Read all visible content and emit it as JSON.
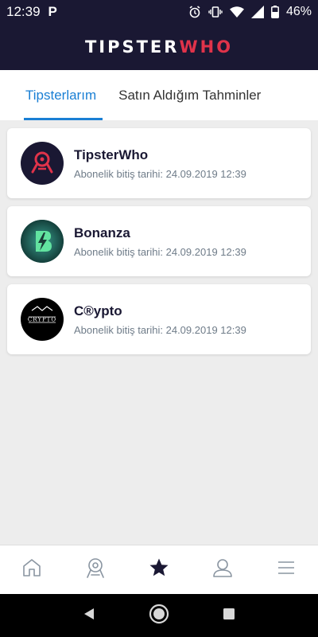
{
  "status_bar": {
    "time": "12:39",
    "p_icon": "P",
    "battery": "46%"
  },
  "header": {
    "logo_part1": "TIPSTER",
    "logo_part2": "WHO"
  },
  "tabs": [
    {
      "label": "Tipsterlarım",
      "active": true
    },
    {
      "label": "Satın Aldığım Tahminler",
      "active": false
    }
  ],
  "tipsters": [
    {
      "name": "TipsterWho",
      "subtitle": "Abonelik bitiş tarihi: 24.09.2019 12:39",
      "avatar_icon": "tipsterwho-logo-icon"
    },
    {
      "name": "Bonanza",
      "subtitle": "Abonelik bitiş tarihi: 24.09.2019 12:39",
      "avatar_icon": "bonanza-logo-icon"
    },
    {
      "name": "C®ypto",
      "subtitle": "Abonelik bitiş tarihi: 24.09.2019 12:39",
      "avatar_icon": "crypto-logo-icon",
      "avatar_text": "CRYPTO"
    }
  ],
  "bottom_nav": [
    {
      "icon": "home-icon"
    },
    {
      "icon": "tipster-icon"
    },
    {
      "icon": "star-icon",
      "active": true
    },
    {
      "icon": "profile-icon"
    },
    {
      "icon": "menu-icon"
    }
  ],
  "colors": {
    "header_bg": "#1a1833",
    "accent": "#1a7fd4",
    "brand_red": "#e0334a"
  }
}
